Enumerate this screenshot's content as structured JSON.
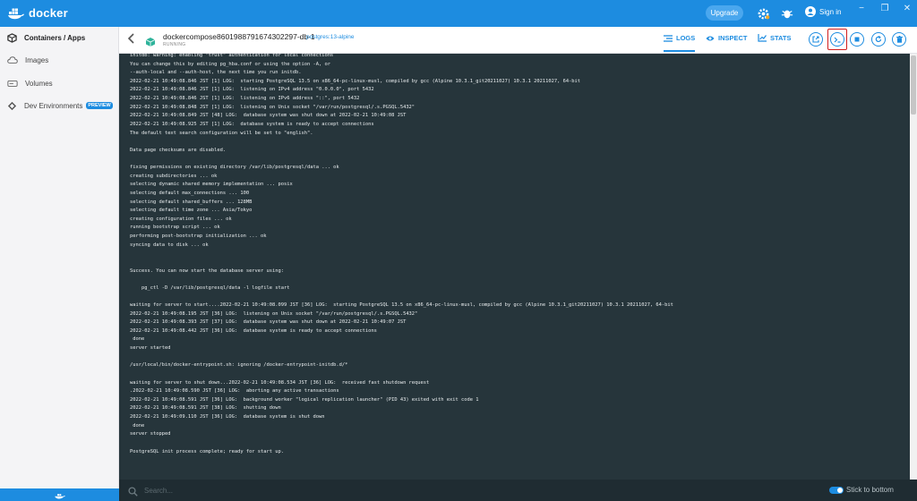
{
  "app": {
    "name": "docker",
    "upgrade_label": "Upgrade",
    "signin_label": "Sign in",
    "window_controls": [
      "−",
      "❐",
      "✕"
    ]
  },
  "sidebar": {
    "items": [
      {
        "label": "Containers / Apps",
        "icon": "containers-icon",
        "active": true
      },
      {
        "label": "Images",
        "icon": "cloud-icon",
        "active": false
      },
      {
        "label": "Volumes",
        "icon": "volume-icon",
        "active": false
      },
      {
        "label": "Dev Environments",
        "icon": "dev-env-icon",
        "active": false,
        "badge": "PREVIEW"
      }
    ]
  },
  "container": {
    "name": "dockercompose8601988791674302297-db-1",
    "image": "postgres:13-alpine",
    "status": "RUNNING"
  },
  "tabs": [
    {
      "label": "LOGS",
      "icon": "logs-icon",
      "active": true
    },
    {
      "label": "INSPECT",
      "icon": "eye-icon",
      "active": false
    },
    {
      "label": "STATS",
      "icon": "stats-icon",
      "active": false
    }
  ],
  "actions": [
    "open-browser",
    "cli",
    "stop",
    "restart",
    "delete"
  ],
  "logs": [
    "initdb: warning: enabling \"trust\" authentication for local connections",
    "You can change this by editing pg_hba.conf or using the option -A, or",
    "--auth-local and --auth-host, the next time you run initdb.",
    "2022-02-21 10:49:08.846 JST [1] LOG:  starting PostgreSQL 13.5 on x86_64-pc-linux-musl, compiled by gcc (Alpine 10.3.1_git20211027) 10.3.1 20211027, 64-bit",
    "2022-02-21 10:49:08.846 JST [1] LOG:  listening on IPv4 address \"0.0.0.0\", port 5432",
    "2022-02-21 10:49:08.846 JST [1] LOG:  listening on IPv6 address \"::\", port 5432",
    "2022-02-21 10:49:08.848 JST [1] LOG:  listening on Unix socket \"/var/run/postgresql/.s.PGSQL.5432\"",
    "2022-02-21 10:49:08.849 JST [48] LOG:  database system was shut down at 2022-02-21 10:49:08 JST",
    "2022-02-21 10:49:08.925 JST [1] LOG:  database system is ready to accept connections",
    "The default text search configuration will be set to \"english\".",
    "",
    "Data page checksums are disabled.",
    "",
    "fixing permissions on existing directory /var/lib/postgresql/data ... ok",
    "creating subdirectories ... ok",
    "selecting dynamic shared memory implementation ... posix",
    "selecting default max_connections ... 100",
    "selecting default shared_buffers ... 128MB",
    "selecting default time zone ... Asia/Tokyo",
    "creating configuration files ... ok",
    "running bootstrap script ... ok",
    "performing post-bootstrap initialization ... ok",
    "syncing data to disk ... ok",
    "",
    "",
    "Success. You can now start the database server using:",
    "",
    "    pg_ctl -D /var/lib/postgresql/data -l logfile start",
    "",
    "waiting for server to start....2022-02-21 10:49:08.099 JST [36] LOG:  starting PostgreSQL 13.5 on x86_64-pc-linux-musl, compiled by gcc (Alpine 10.3.1_git20211027) 10.3.1 20211027, 64-bit",
    "2022-02-21 10:49:08.195 JST [36] LOG:  listening on Unix socket \"/var/run/postgresql/.s.PGSQL.5432\"",
    "2022-02-21 10:49:08.393 JST [37] LOG:  database system was shut down at 2022-02-21 10:49:07 JST",
    "2022-02-21 10:49:08.442 JST [36] LOG:  database system is ready to accept connections",
    " done",
    "server started",
    "",
    "/usr/local/bin/docker-entrypoint.sh: ignoring /docker-entrypoint-initdb.d/*",
    "",
    "waiting for server to shut down...2022-02-21 10:49:08.534 JST [36] LOG:  received fast shutdown request",
    ".2022-02-21 10:49:08.590 JST [36] LOG:  aborting any active transactions",
    "2022-02-21 10:49:08.591 JST [36] LOG:  background worker \"logical replication launcher\" (PID 43) exited with exit code 1",
    "2022-02-21 10:49:08.591 JST [38] LOG:  shutting down",
    "2022-02-21 10:49:09.110 JST [36] LOG:  database system is shut down",
    " done",
    "server stopped",
    "",
    "PostgreSQL init process complete; ready for start up."
  ],
  "search": {
    "placeholder": "Search...",
    "value": "",
    "stick_label": "Stick to bottom",
    "stick_enabled": true
  },
  "colors": {
    "accent": "#1d8ce0",
    "log_bg": "#26353b",
    "highlight": "#d21e1e"
  }
}
